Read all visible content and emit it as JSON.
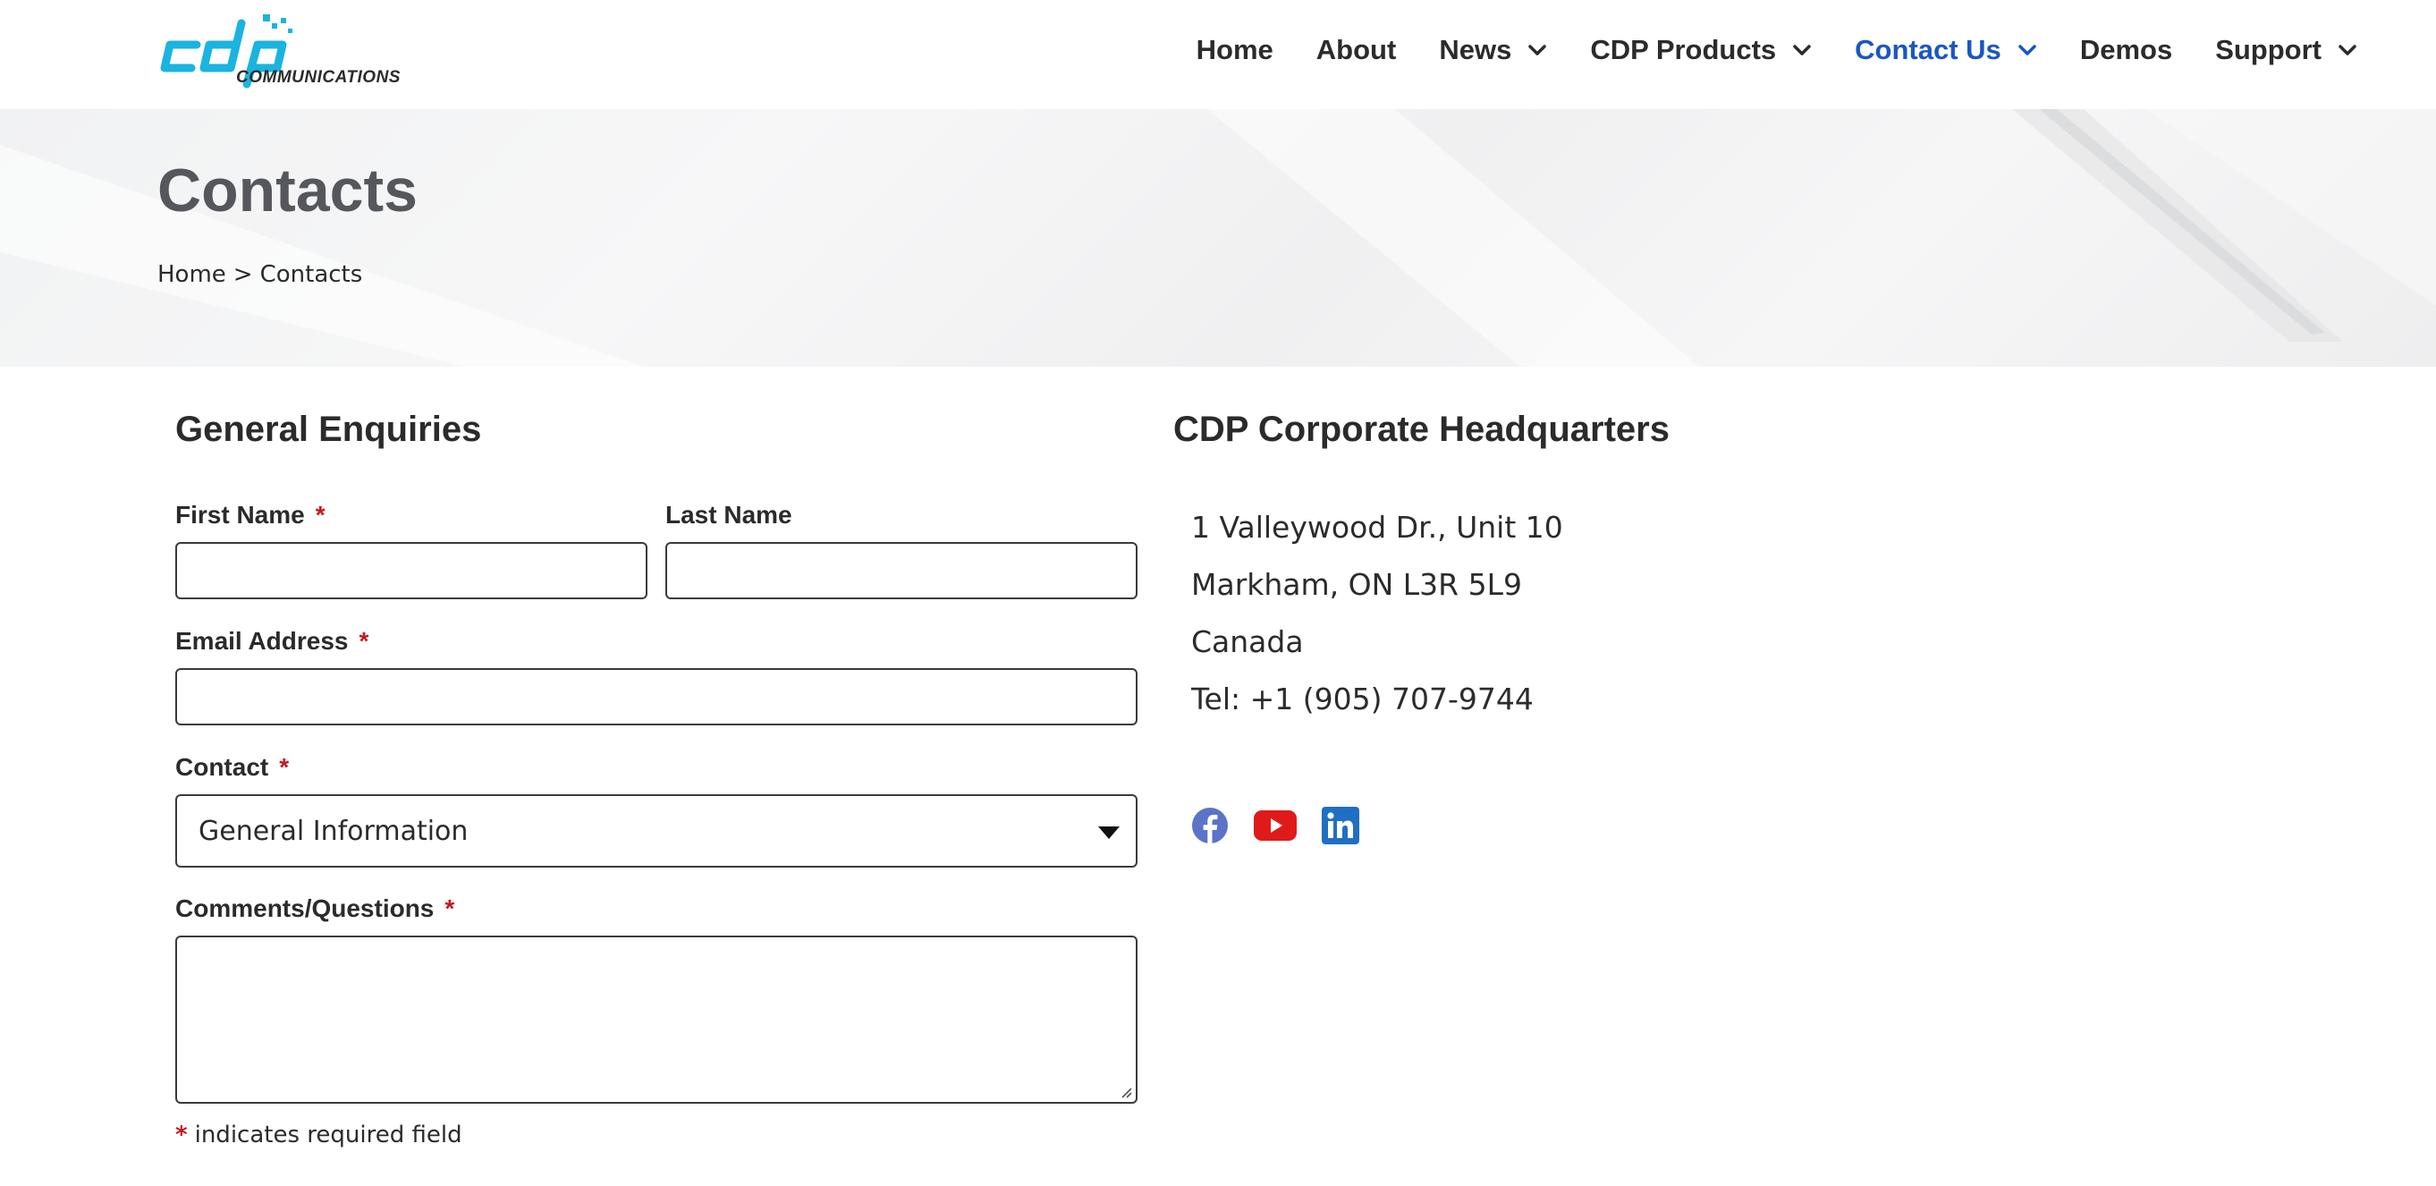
{
  "brand": {
    "logo_text": "COMMUNICATIONS",
    "logo_color": "#1bb3e0"
  },
  "nav": {
    "items": [
      {
        "label": "Home",
        "has_dropdown": false,
        "active": false
      },
      {
        "label": "About",
        "has_dropdown": false,
        "active": false
      },
      {
        "label": "News",
        "has_dropdown": true,
        "active": false
      },
      {
        "label": "CDP Products",
        "has_dropdown": true,
        "active": false
      },
      {
        "label": "Contact Us",
        "has_dropdown": true,
        "active": true
      },
      {
        "label": "Demos",
        "has_dropdown": false,
        "active": false
      },
      {
        "label": "Support",
        "has_dropdown": true,
        "active": false
      }
    ],
    "active_color": "#1a56c4"
  },
  "banner": {
    "title": "Contacts",
    "breadcrumb": {
      "home": "Home",
      "separator": ">",
      "current": "Contacts"
    }
  },
  "form": {
    "heading": "General Enquiries",
    "required_mark": "*",
    "first_name": {
      "label": "First Name",
      "value": ""
    },
    "last_name": {
      "label": "Last Name",
      "value": ""
    },
    "email": {
      "label": "Email Address",
      "value": ""
    },
    "contact": {
      "label": "Contact",
      "selected": "General Information"
    },
    "comments": {
      "label": "Comments/Questions",
      "value": ""
    },
    "required_note": "indicates required field",
    "required_color": "#c8161d"
  },
  "hq": {
    "heading": "CDP Corporate Headquarters",
    "address_lines": [
      "1 Valleywood Dr., Unit 10",
      "Markham, ON L3R 5L9",
      "Canada",
      "Tel: +1 (905) 707-9744"
    ],
    "social": [
      {
        "name": "facebook-icon",
        "color": "#5b73c8"
      },
      {
        "name": "youtube-icon",
        "color": "#e01a1a"
      },
      {
        "name": "linkedin-icon",
        "color": "#1f6fc4"
      }
    ]
  }
}
